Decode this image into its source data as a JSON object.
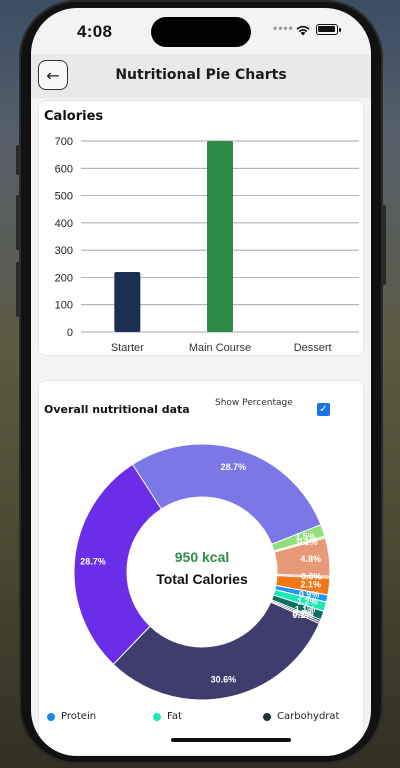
{
  "status_bar": {
    "time": "4:08",
    "dots": "••••"
  },
  "app_bar": {
    "title": "Nutritional Pie Charts"
  },
  "calories_card": {
    "title": "Calories"
  },
  "overall_card": {
    "title": "Overall nutritional data",
    "show_percentage_label": "Show Percentage",
    "checkbox_checked": true,
    "center_value": "950 kcal",
    "center_label": "Total Calories"
  },
  "legend": [
    {
      "label": "Protein",
      "color": "#1e88e5"
    },
    {
      "label": "Fat",
      "color": "#1de9b6"
    },
    {
      "label": "Carbohydrat",
      "color": "#263238"
    }
  ],
  "chart_data": [
    {
      "type": "bar",
      "title": "Calories",
      "categories": [
        "Starter",
        "Main Course",
        "Dessert"
      ],
      "values": [
        220,
        700,
        0
      ],
      "ylim": [
        0,
        700
      ],
      "yticks": [
        0,
        100,
        200,
        300,
        400,
        500,
        600,
        700
      ],
      "colors": [
        "#1b2f55",
        "#2e8b47",
        "#2e8b47"
      ],
      "grid": true
    },
    {
      "type": "pie",
      "title": "Overall nutritional data",
      "slices": [
        {
          "value": 28.7,
          "label": "28.7%",
          "color": "#7c77e6"
        },
        {
          "value": 1.5,
          "label": "1.5%",
          "color": "#8de07a"
        },
        {
          "value": 0.1,
          "label": "0.1%",
          "color": "#b6e3a5"
        },
        {
          "value": 4.8,
          "label": "4.8%",
          "color": "#e89a78"
        },
        {
          "value": 0.0,
          "label": "0.0%",
          "color": "#f4a23d"
        },
        {
          "value": 2.1,
          "label": "2.1%",
          "color": "#f2761a"
        },
        {
          "value": 0.9,
          "label": "0.9%",
          "color": "#2196f3"
        },
        {
          "value": 1.2,
          "label": "1.2%",
          "color": "#1de9b6"
        },
        {
          "value": 1.1,
          "label": "1.1%",
          "color": "#0b6e67"
        },
        {
          "value": 0.2,
          "label": "0.2%",
          "color": "#153b45"
        },
        {
          "value": 0.1,
          "label": "0.1%",
          "color": "#3f3f60"
        },
        {
          "value": 30.6,
          "label": "30.6%",
          "color": "#3f3d6e"
        },
        {
          "value": 28.7,
          "label": "28.7%",
          "color": "#6a2ee8"
        }
      ]
    }
  ]
}
